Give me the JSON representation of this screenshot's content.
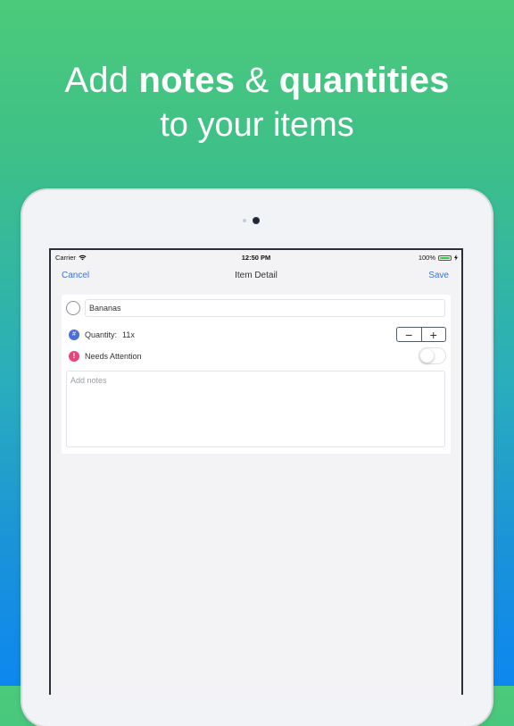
{
  "headline": {
    "line1_prefix": "Add ",
    "line1_bold1": "notes",
    "line1_mid": " & ",
    "line1_bold2": "quantities",
    "line2": "to your items"
  },
  "status_bar": {
    "carrier": "Carrier",
    "time": "12:50 PM",
    "battery": "100%",
    "battery_level": 1.0
  },
  "nav": {
    "cancel": "Cancel",
    "title": "Item Detail",
    "save": "Save"
  },
  "item": {
    "name": "Bananas",
    "quantity_label": "Quantity:",
    "quantity_value": "11x",
    "quantity_icon": "#",
    "minus": "−",
    "plus": "+",
    "attention_icon": "!",
    "attention_label": "Needs Attention",
    "attention_on": false,
    "notes_placeholder": "Add notes"
  },
  "colors": {
    "accent": "#3b73d9",
    "quantity_icon": "#4a6fd8",
    "attention_icon": "#e8457a",
    "battery": "#2ecc40"
  }
}
